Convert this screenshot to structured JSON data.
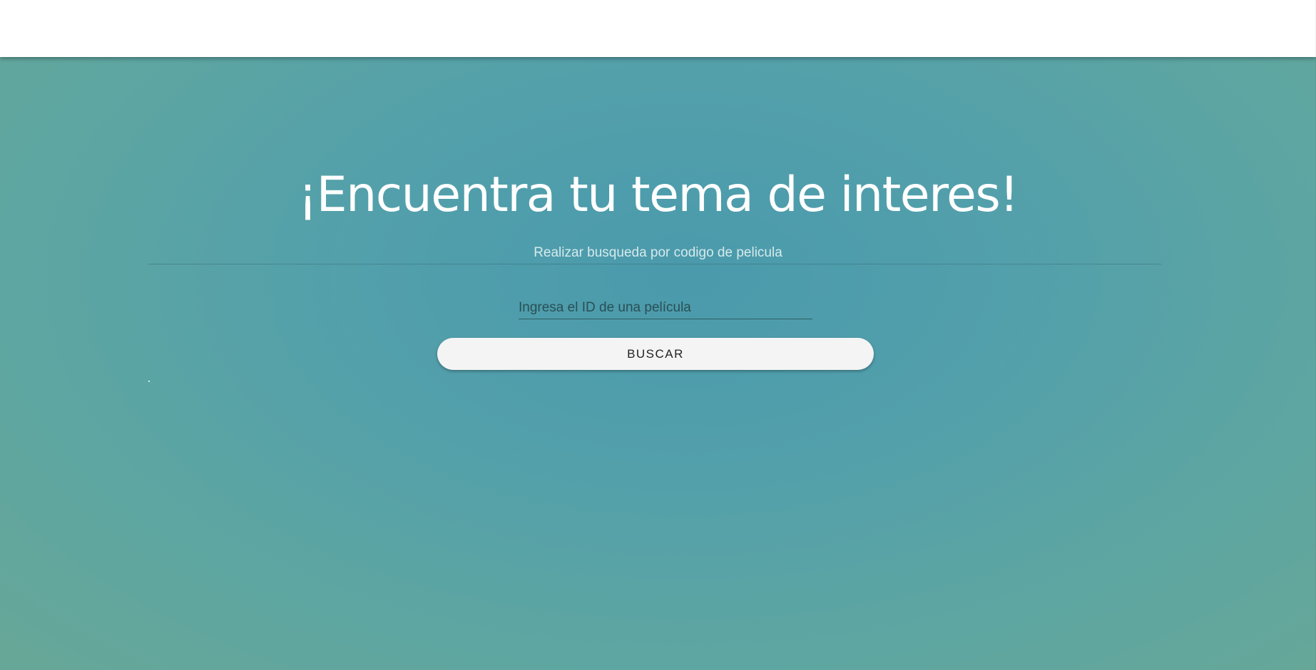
{
  "colors": {
    "header_bg": "#ffffff",
    "hero_gradient_center": "#4a9aac",
    "hero_gradient_edge": "#67a797",
    "title_text": "#ffffff",
    "subtitle_text": "#d6eaec",
    "button_bg": "#f4f4f4",
    "button_text": "#222222"
  },
  "hero": {
    "title": "¡Encuentra tu tema de interes!",
    "subtitle": "Realizar busqueda por codigo de pelicula"
  },
  "search": {
    "placeholder": "Ingresa el ID de una película",
    "value": "",
    "button_label": "BUSCAR"
  }
}
